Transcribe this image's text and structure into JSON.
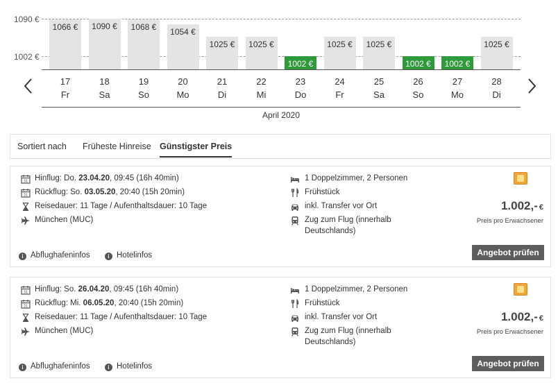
{
  "calendar": {
    "ref_labels": {
      "high": "1090 €",
      "low": "1002 €"
    },
    "month": "April 2020",
    "days": [
      {
        "date": "17",
        "weekday": "Fr",
        "price": 1066,
        "label": "1066 €",
        "cheapest": false
      },
      {
        "date": "18",
        "weekday": "Sa",
        "price": 1090,
        "label": "1090 €",
        "cheapest": false
      },
      {
        "date": "19",
        "weekday": "So",
        "price": 1068,
        "label": "1068 €",
        "cheapest": false
      },
      {
        "date": "20",
        "weekday": "Mo",
        "price": 1054,
        "label": "1054 €",
        "cheapest": false
      },
      {
        "date": "21",
        "weekday": "Di",
        "price": 1025,
        "label": "1025 €",
        "cheapest": false
      },
      {
        "date": "22",
        "weekday": "Mi",
        "price": 1025,
        "label": "1025 €",
        "cheapest": false
      },
      {
        "date": "23",
        "weekday": "Do",
        "price": 1002,
        "label": "1002 €",
        "cheapest": true
      },
      {
        "date": "24",
        "weekday": "Fr",
        "price": 1025,
        "label": "1025 €",
        "cheapest": false
      },
      {
        "date": "25",
        "weekday": "Sa",
        "price": 1025,
        "label": "1025 €",
        "cheapest": false
      },
      {
        "date": "26",
        "weekday": "So",
        "price": 1002,
        "label": "1002 €",
        "cheapest": true
      },
      {
        "date": "27",
        "weekday": "Mo",
        "price": 1002,
        "label": "1002 €",
        "cheapest": true
      },
      {
        "date": "28",
        "weekday": "Di",
        "price": 1025,
        "label": "1025 €",
        "cheapest": false
      }
    ],
    "colors": {
      "bar": "#e4e4e4",
      "cheapest": "#2f9a3a"
    }
  },
  "sort": {
    "label": "Sortiert nach",
    "option_earliest": "Früheste Hinreise",
    "option_cheapest": "Günstigster Preis",
    "active": "Günstigster Preis"
  },
  "offers": [
    {
      "outbound_prefix": "Hinflug: Do. ",
      "outbound_date": "23.04.20",
      "outbound_suffix": ", 09:45 (16h 40min)",
      "return_prefix": "Rückflug: So. ",
      "return_date": "03.05.20",
      "return_suffix": ", 20:40 (15h 20min)",
      "duration": "Reisedauer: 11 Tage / Aufenthaltsdauer: 10 Tage",
      "airport": "München (MUC)",
      "room": "1 Doppelzimmer, 2 Personen",
      "board": "Frühstück",
      "transfer": "inkl. Transfer vor Ort",
      "train_line1": "Zug zum Flug (innerhalb",
      "train_line2": "Deutschlands)",
      "price": "1.002,-",
      "currency": "€",
      "price_note": "Preis pro Erwachsener",
      "check_button": "Angebot prüfen",
      "airport_info": "Abflughafeninfos",
      "hotel_info": "Hotelinfos"
    },
    {
      "outbound_prefix": "Hinflug: So. ",
      "outbound_date": "26.04.20",
      "outbound_suffix": ", 09:45 (16h 40min)",
      "return_prefix": "Rückflug: Mi. ",
      "return_date": "06.05.20",
      "return_suffix": ", 20:40 (15h 20min)",
      "duration": "Reisedauer: 11 Tage / Aufenthaltsdauer: 10 Tage",
      "airport": "München (MUC)",
      "room": "1 Doppelzimmer, 2 Personen",
      "board": "Frühstück",
      "transfer": "inkl. Transfer vor Ort",
      "train_line1": "Zug zum Flug (innerhalb",
      "train_line2": "Deutschlands)",
      "price": "1.002,-",
      "currency": "€",
      "price_note": "Preis pro Erwachsener",
      "check_button": "Angebot prüfen",
      "airport_info": "Abflughafeninfos",
      "hotel_info": "Hotelinfos"
    }
  ]
}
